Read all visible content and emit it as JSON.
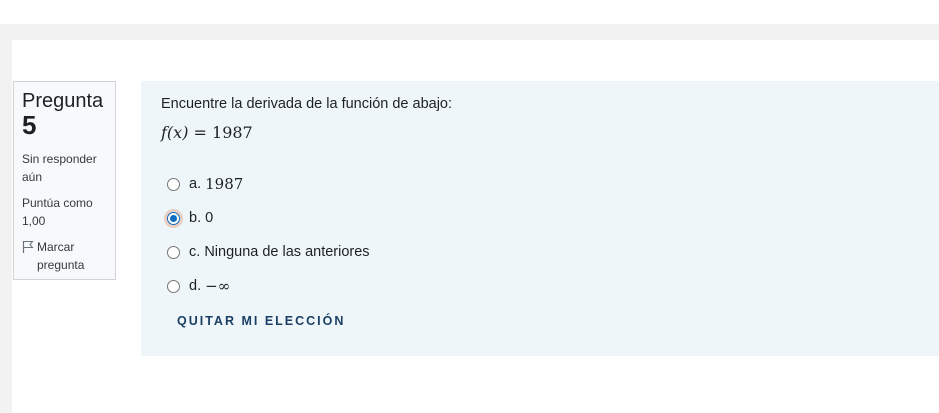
{
  "question": {
    "label": "Pregunta",
    "number": "5",
    "state": "Sin responder aún",
    "grade": "Puntúa como 1,00",
    "flag_label": "Marcar pregunta",
    "text": "Encuentre la derivada de la función de abajo:",
    "formula": {
      "lhs": "f(x)",
      "eq": " = ",
      "rhs": "1987"
    }
  },
  "answers": [
    {
      "letter": "a.",
      "text": "1987",
      "selected": false
    },
    {
      "letter": "b.",
      "text": "0",
      "selected": true
    },
    {
      "letter": "c.",
      "text": "Ninguna de las anteriores",
      "selected": false
    },
    {
      "letter": "d.",
      "text": "−∞",
      "selected": false
    }
  ],
  "clear_choice_label": "QUITAR MI ELECCIÓN",
  "colors": {
    "content_bg": "#eef6f9",
    "info_bg": "#f8f9fa",
    "radio_checked": "#0f6cbf",
    "link": "#1b3f63"
  },
  "icons": {
    "flag": "flag-icon"
  }
}
